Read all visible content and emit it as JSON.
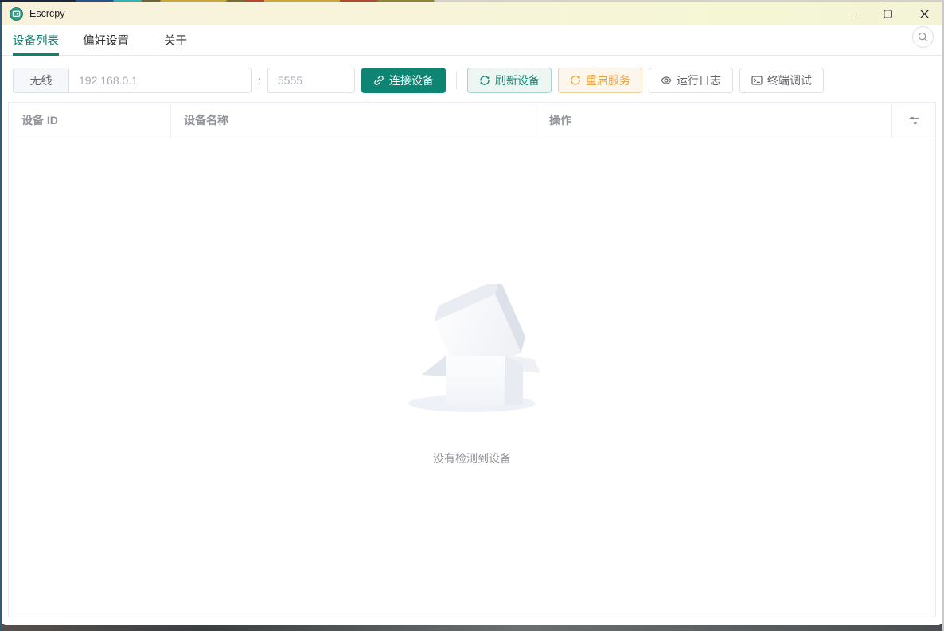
{
  "window": {
    "title": "Escrcpy"
  },
  "tabs": {
    "items": [
      {
        "label": "设备列表",
        "active": true
      },
      {
        "label": "偏好设置",
        "active": false
      },
      {
        "label": "关于",
        "active": false
      }
    ]
  },
  "toolbar": {
    "wireless_label": "无线",
    "ip_input": {
      "value": "",
      "placeholder": "192.168.0.1"
    },
    "port_separator": ":",
    "port_input": {
      "value": "",
      "placeholder": "5555"
    },
    "connect_button": "连接设备",
    "refresh_button": "刷新设备",
    "restart_button": "重启服务",
    "logs_button": "运行日志",
    "terminal_button": "终端调试"
  },
  "device_table": {
    "columns": [
      {
        "label": "设备 ID"
      },
      {
        "label": "设备名称"
      },
      {
        "label": "操作"
      }
    ],
    "rows": [],
    "empty_text": "没有检测到设备"
  },
  "icons": {
    "app-icon": "escrcpy-logo-green-circle",
    "minimize-icon": "thin-dash",
    "maximize-icon": "square-outline",
    "close-icon": "x-cross",
    "search-icon": "magnifier",
    "connect-icon": "chain-link",
    "refresh-icon": "circular-arrows",
    "restart-icon": "refresh-right-arrow",
    "logs-icon": "eye",
    "terminal-icon": "terminal-prompt-box",
    "column-settings-icon": "horizontal-sliders"
  },
  "colors": {
    "primary": "#0e8573",
    "warning": "#e6a23c",
    "titlebar_bg": "#f7f3dc",
    "header_text": "#909399",
    "border": "#dcdfe6"
  }
}
